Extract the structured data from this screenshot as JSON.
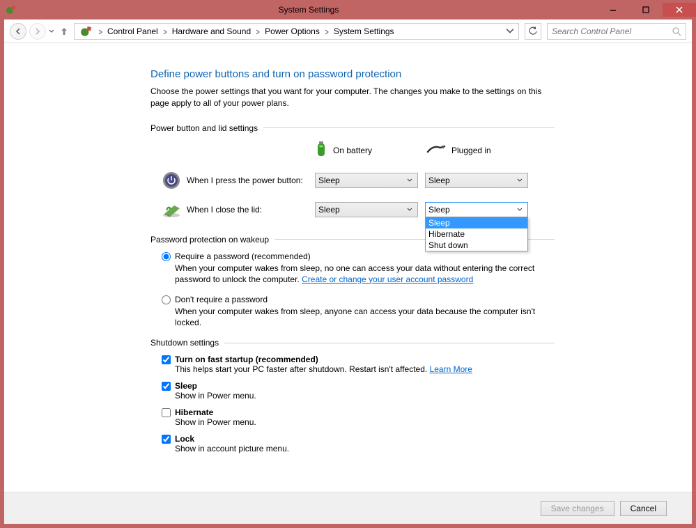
{
  "window": {
    "title": "System Settings"
  },
  "breadcrumb": {
    "items": [
      "Control Panel",
      "Hardware and Sound",
      "Power Options",
      "System Settings"
    ]
  },
  "search": {
    "placeholder": "Search Control Panel"
  },
  "page": {
    "title": "Define power buttons and turn on password protection",
    "subtitle": "Choose the power settings that you want for your computer. The changes you make to the settings on this page apply to all of your power plans."
  },
  "section_power": {
    "label": "Power button and lid settings",
    "col_battery": "On battery",
    "col_plugged": "Plugged in",
    "row1_label": "When I press the power button:",
    "row2_label": "When I close the lid:",
    "row1_battery_value": "Sleep",
    "row1_plugged_value": "Sleep",
    "row2_battery_value": "Sleep",
    "row2_plugged_value": "Sleep",
    "dropdown_options": {
      "o1": "Sleep",
      "o2": "Hibernate",
      "o3": "Shut down"
    }
  },
  "section_password": {
    "label": "Password protection on wakeup",
    "opt1_label": "Require a password (recommended)",
    "opt1_desc_part1": "When your computer wakes from sleep, no one can access your data without entering the correct password to unlock the computer. ",
    "opt1_link": "Create or change your user account password",
    "opt2_label": "Don't require a password",
    "opt2_desc": "When your computer wakes from sleep, anyone can access your data because the computer isn't locked."
  },
  "section_shutdown": {
    "label": "Shutdown settings",
    "c1_label": "Turn on fast startup (recommended)",
    "c1_desc_part1": "This helps start your PC faster after shutdown. Restart isn't affected. ",
    "c1_link": "Learn More",
    "c2_label": "Sleep",
    "c2_desc": "Show in Power menu.",
    "c3_label": "Hibernate",
    "c3_desc": "Show in Power menu.",
    "c4_label": "Lock",
    "c4_desc": "Show in account picture menu."
  },
  "buttons": {
    "save": "Save changes",
    "cancel": "Cancel"
  }
}
